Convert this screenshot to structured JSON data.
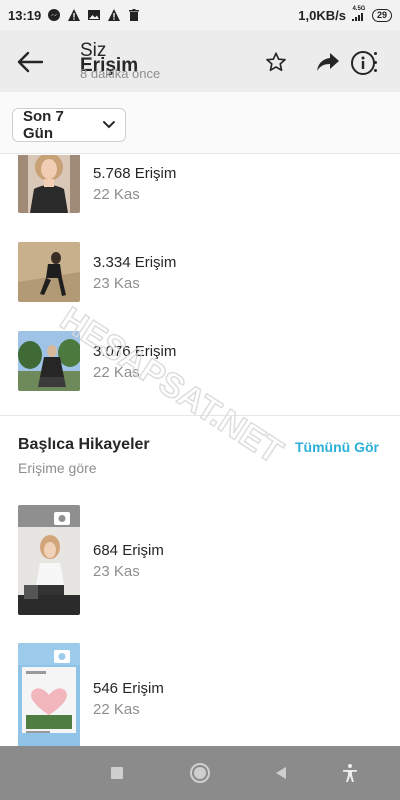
{
  "status_bar": {
    "time": "13:19",
    "network_speed": "1,0KB/s",
    "network_type": "4.5G",
    "battery": "29"
  },
  "header": {
    "title_line1": "Siz",
    "title_line2": "Erişim",
    "subtitle": "8 dakika önce"
  },
  "filter": {
    "period_label": "Son 7 Gün"
  },
  "posts": [
    {
      "metric": "5.768 Erişim",
      "date": "22 Kas"
    },
    {
      "metric": "3.334 Erişim",
      "date": "23 Kas"
    },
    {
      "metric": "3.076 Erişim",
      "date": "22 Kas"
    }
  ],
  "stories_section": {
    "title": "Başlıca Hikayeler",
    "subtitle": "Erişime göre",
    "see_all": "Tümünü Gör"
  },
  "stories": [
    {
      "metric": "684 Erişim",
      "date": "23 Kas"
    },
    {
      "metric": "546 Erişim",
      "date": "22 Kas"
    }
  ],
  "watermark": "HESAPSAT.NET",
  "colors": {
    "accent": "#2bb0d8",
    "header_bg": "#ececec",
    "nav_bg": "#8b8b8b"
  }
}
